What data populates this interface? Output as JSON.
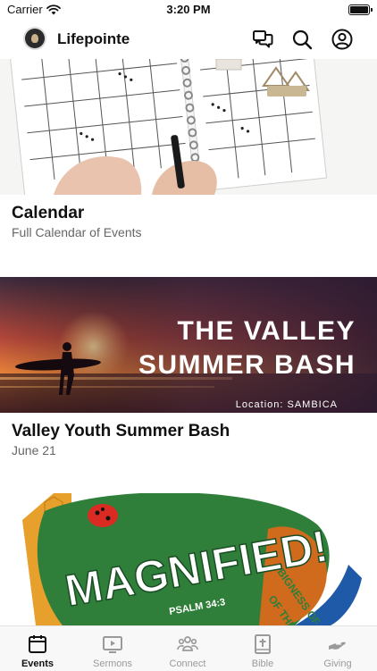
{
  "status": {
    "carrier": "Carrier",
    "time": "3:20 PM"
  },
  "header": {
    "title": "Lifepointe"
  },
  "cards": [
    {
      "title": "Calendar",
      "subtitle": "Full Calendar of Events"
    },
    {
      "title": "Valley Youth Summer Bash",
      "subtitle": "June 21",
      "image_text": {
        "line1": "THE VALLEY",
        "line2": "SUMMER BASH",
        "location": "Location: SAMBICA"
      }
    },
    {
      "title": "",
      "image_text": {
        "word": "MAGNIFIED!",
        "ref": "PSALM 34:3",
        "side1": "BIGNESS OF GOD",
        "side2": "OF THINGS"
      }
    }
  ],
  "tabs": [
    {
      "label": "Events",
      "active": true
    },
    {
      "label": "Sermons"
    },
    {
      "label": "Connect"
    },
    {
      "label": "Bible"
    },
    {
      "label": "Giving"
    }
  ]
}
